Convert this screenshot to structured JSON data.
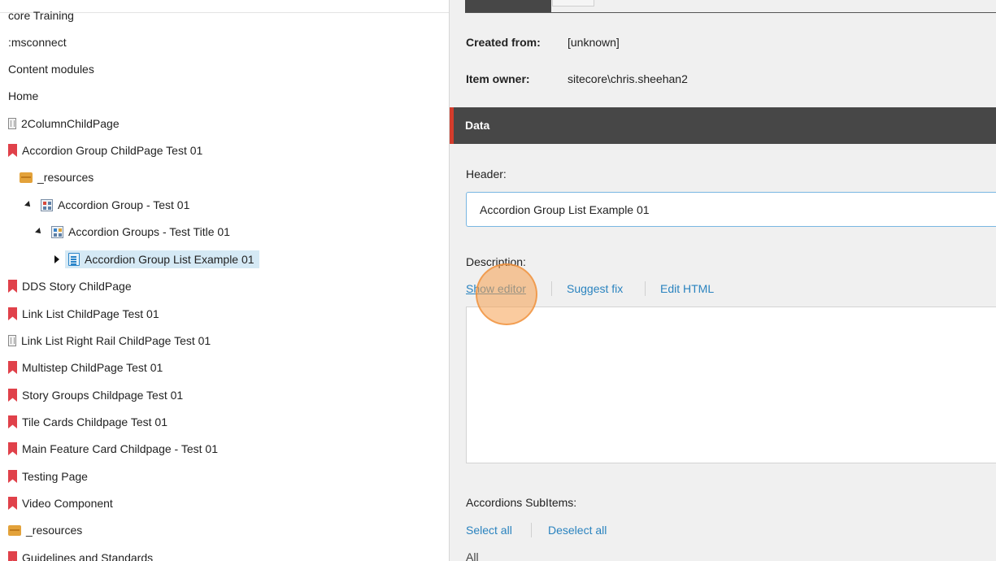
{
  "tree": {
    "items": [
      {
        "label": "core Training",
        "icon": "none"
      },
      {
        "label": ":msconnect",
        "icon": "none"
      },
      {
        "label": "Content modules",
        "icon": "none"
      },
      {
        "label": "Home",
        "icon": "none"
      },
      {
        "label": "2ColumnChildPage",
        "icon": "page-doc-icon"
      },
      {
        "label": "Accordion Group ChildPage Test 01",
        "icon": "bookmark-icon"
      },
      {
        "label": "_resources",
        "icon": "resources-box-icon"
      },
      {
        "label": "Accordion Group - Test 01",
        "icon": "component-grid-icon"
      },
      {
        "label": "Accordion Groups - Test Title 01",
        "icon": "component-grid-icon"
      },
      {
        "label": "Accordion Group List Example 01",
        "icon": "list-item-icon"
      },
      {
        "label": "DDS Story ChildPage",
        "icon": "bookmark-icon"
      },
      {
        "label": "Link List ChildPage Test 01",
        "icon": "bookmark-icon"
      },
      {
        "label": "Link List Right Rail ChildPage Test 01",
        "icon": "page-doc-icon"
      },
      {
        "label": "Multistep ChildPage Test 01",
        "icon": "bookmark-icon"
      },
      {
        "label": "Story Groups Childpage Test 01",
        "icon": "bookmark-icon"
      },
      {
        "label": "Tile Cards Childpage Test 01",
        "icon": "bookmark-icon"
      },
      {
        "label": "Main Feature Card Childpage - Test 01",
        "icon": "bookmark-icon"
      },
      {
        "label": "Testing Page",
        "icon": "bookmark-icon"
      },
      {
        "label": "Video Component",
        "icon": "bookmark-icon"
      },
      {
        "label": "_resources",
        "icon": "resources-box-icon"
      },
      {
        "label": "Guidelines and Standards",
        "icon": "bookmark-icon"
      }
    ]
  },
  "details": {
    "created_from_label": "Created from:",
    "created_from_value": "[unknown]",
    "item_owner_label": "Item owner:",
    "item_owner_value": "sitecore\\chris.sheehan2"
  },
  "data_section": {
    "title": "Data",
    "header_label": "Header:",
    "header_value": "Accordion Group List Example 01",
    "description_label": "Description:",
    "show_editor": "Show editor",
    "suggest_fix": "Suggest fix",
    "edit_html": "Edit HTML",
    "subitems_label": "Accordions SubItems:",
    "select_all": "Select all",
    "deselect_all": "Deselect all",
    "all_label": "All"
  },
  "colors": {
    "section_bar": "#474747",
    "section_accent": "#d33c2c",
    "link": "#2a83bf",
    "selected_row": "#d5e9f5",
    "click_highlight": "#f5a050"
  }
}
